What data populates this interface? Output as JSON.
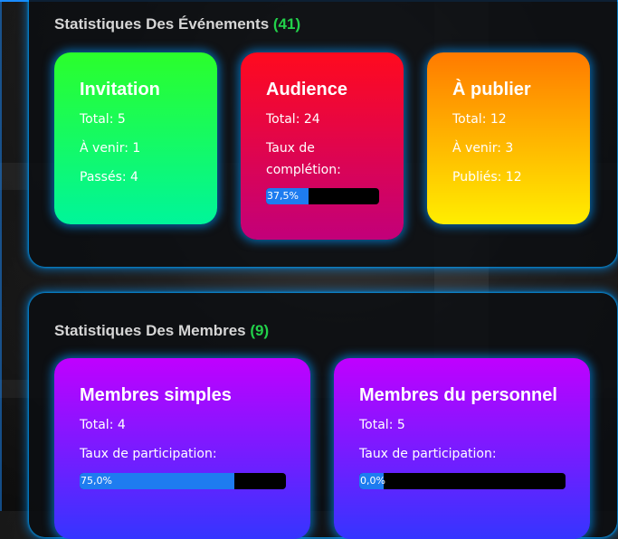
{
  "events": {
    "title": "Statistiques Des Événements",
    "count": "(41)",
    "cards": {
      "invitation": {
        "title": "Invitation",
        "l1": "Total: 5",
        "l2": "À venir: 1",
        "l3": "Passés: 4"
      },
      "audience": {
        "title": "Audience",
        "l1": "Total: 24",
        "l2a": "Taux de",
        "l2b": "complétion:",
        "bar_text": "37,5%",
        "progress": 0.375
      },
      "publier": {
        "title": "À publier",
        "l1": "Total: 12",
        "l2": "À venir: 3",
        "l3": "Publiés: 12"
      }
    }
  },
  "members": {
    "title": "Statistiques Des Membres",
    "count": "(9)",
    "cards": {
      "simples": {
        "title": "Membres simples",
        "l1": "Total: 4",
        "l2": "Taux de participation:",
        "bar_text": "75,0%",
        "progress": 0.75
      },
      "personnel": {
        "title": "Membres du personnel",
        "l1": "Total: 5",
        "l2": "Taux de participation:",
        "bar_text": "0,0%",
        "progress": 0.0
      }
    }
  },
  "colors": {
    "accent_border": "#1a8cff",
    "count_green": "#22d14a",
    "progress_fill": "#1e7cf0"
  }
}
